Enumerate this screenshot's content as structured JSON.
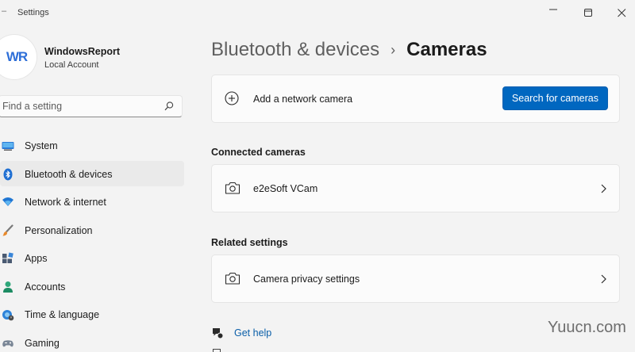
{
  "app": {
    "title": "Settings"
  },
  "profile": {
    "avatar_text": "WR",
    "name": "WindowsReport",
    "account_type": "Local Account"
  },
  "search": {
    "placeholder": "Find a setting",
    "value": ""
  },
  "nav": {
    "items": [
      {
        "label": "System",
        "icon": "monitor-icon",
        "selected": false
      },
      {
        "label": "Bluetooth & devices",
        "icon": "bluetooth-icon",
        "selected": true
      },
      {
        "label": "Network & internet",
        "icon": "wifi-icon",
        "selected": false
      },
      {
        "label": "Personalization",
        "icon": "brush-icon",
        "selected": false
      },
      {
        "label": "Apps",
        "icon": "apps-icon",
        "selected": false
      },
      {
        "label": "Accounts",
        "icon": "person-icon",
        "selected": false
      },
      {
        "label": "Time & language",
        "icon": "globe-clock-icon",
        "selected": false
      },
      {
        "label": "Gaming",
        "icon": "gamepad-icon",
        "selected": false
      }
    ]
  },
  "breadcrumb": {
    "parent": "Bluetooth & devices",
    "separator": "›",
    "current": "Cameras"
  },
  "add_camera": {
    "label": "Add a network camera",
    "button_label": "Search for cameras",
    "icon": "plus-circle-icon"
  },
  "connected": {
    "title": "Connected cameras",
    "cameras": [
      {
        "name": "e2eSoft VCam",
        "icon": "camera-icon"
      }
    ]
  },
  "related": {
    "title": "Related settings",
    "items": [
      {
        "label": "Camera privacy settings",
        "icon": "camera-icon"
      }
    ]
  },
  "help": {
    "label": "Get help",
    "icon": "help-chat-icon"
  },
  "watermark": {
    "text": "Yuucn.com"
  },
  "colors": {
    "accent": "#0067c0",
    "background": "#f3f3f3",
    "card": "#fbfbfb",
    "link": "#0a5ea8"
  }
}
